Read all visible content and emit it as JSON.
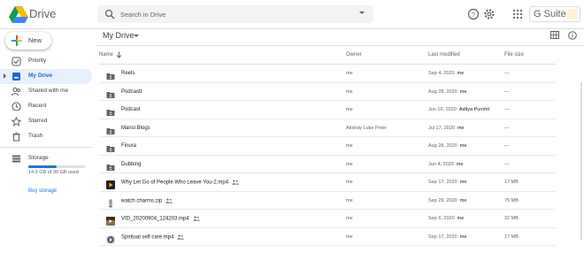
{
  "header": {
    "app_name": "Drive",
    "search_placeholder": "Search in Drive",
    "gsuite_label": "G Suite"
  },
  "sidebar": {
    "new_label": "New",
    "items": [
      {
        "label": "Priority",
        "icon": "check-circle-icon",
        "active": false
      },
      {
        "label": "My Drive",
        "icon": "my-drive-icon",
        "active": true
      },
      {
        "label": "Shared with me",
        "icon": "people-icon",
        "active": false
      },
      {
        "label": "Recent",
        "icon": "clock-icon",
        "active": false
      },
      {
        "label": "Starred",
        "icon": "star-icon",
        "active": false
      },
      {
        "label": "Trash",
        "icon": "trash-icon",
        "active": false
      },
      {
        "label": "Storage",
        "icon": "storage-icon",
        "active": false
      }
    ],
    "storage": {
      "used_text": "14.9 GB of 30 GB used",
      "used_fraction": 0.497,
      "buy_label": "Buy storage"
    }
  },
  "main": {
    "title": "My Drive",
    "columns": {
      "name": "Name",
      "owner": "Owner",
      "modified": "Last modified",
      "size": "File size"
    },
    "files": [
      {
        "name": "Reels",
        "type": "shared-folder",
        "shared": false,
        "owner": "me",
        "modified": "Sep 4, 2020",
        "modified_by": "me",
        "size": "—"
      },
      {
        "name": "Podcastt",
        "type": "shared-folder",
        "shared": false,
        "owner": "me",
        "modified": "Aug 28, 2020",
        "modified_by": "me",
        "size": "—"
      },
      {
        "name": "Podcast",
        "type": "shared-folder",
        "shared": false,
        "owner": "me",
        "modified": "Jun 16, 2020",
        "modified_by": "Aditya Purohit",
        "size": "—"
      },
      {
        "name": "Mansi Blogs",
        "type": "shared-folder",
        "shared": false,
        "owner": "Akshay Luke Peter",
        "modified": "Jul 17, 2020",
        "modified_by": "me",
        "size": "—"
      },
      {
        "name": "Finura",
        "type": "shared-folder",
        "shared": false,
        "owner": "me",
        "modified": "Aug 28, 2020",
        "modified_by": "me",
        "size": "—"
      },
      {
        "name": "Dubbing",
        "type": "shared-folder",
        "shared": false,
        "owner": "me",
        "modified": "Jun 4, 2020",
        "modified_by": "me",
        "size": "—"
      },
      {
        "name": "Why Let Go of People Who Leave You-2.mp4",
        "type": "video",
        "shared": true,
        "owner": "me",
        "modified": "Sep 17, 2020",
        "modified_by": "me",
        "size": "17 MB"
      },
      {
        "name": "watch charms.zip",
        "type": "zip",
        "shared": true,
        "owner": "me",
        "modified": "Sep 29, 2020",
        "modified_by": "me",
        "size": "75 MB"
      },
      {
        "name": "VID_20200904_124203.mp4",
        "type": "video-thumb",
        "shared": true,
        "owner": "me",
        "modified": "Sep 6, 2020",
        "modified_by": "me",
        "size": "32 MB"
      },
      {
        "name": "Spiritual self care.mp4",
        "type": "video-round",
        "shared": true,
        "owner": "me",
        "modified": "Sep 17, 2020",
        "modified_by": "me",
        "size": "17 MB"
      }
    ]
  }
}
